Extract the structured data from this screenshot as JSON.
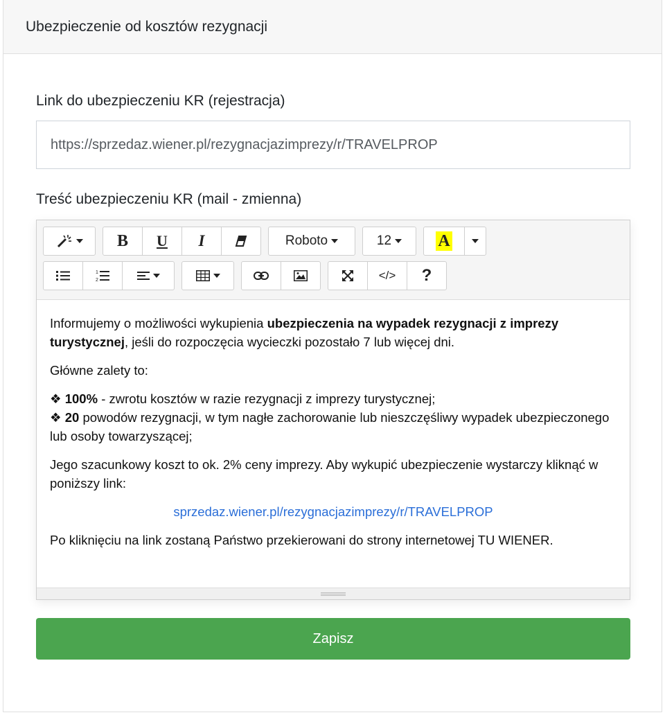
{
  "card": {
    "title": "Ubezpieczenie od kosztów rezygnacji"
  },
  "link_field": {
    "label": "Link do ubezpieczeniu KR (rejestracja)",
    "value": "https://sprzedaz.wiener.pl/rezygnacjazimprezy/r/TRAVELPROP"
  },
  "content_field": {
    "label": "Treść ubezpieczeniu KR (mail - zmienna)"
  },
  "toolbar": {
    "font_name": "Roboto",
    "font_size": "12",
    "bold_glyph": "B",
    "underline_glyph": "U",
    "italic_glyph": "I",
    "color_glyph": "A",
    "codeview_glyph": "</>",
    "help_glyph": "?",
    "highlight_color": "#ffff00"
  },
  "editor": {
    "p1_before": "Informujemy o możliwości wykupienia ",
    "p1_bold": "ubezpieczenia na wypadek rezygnacji z imprezy turystycznej",
    "p1_after": ", jeśli do rozpoczęcia wycieczki pozostało 7 lub więcej dni.",
    "p2": "Główne zalety to:",
    "bullet1_mark": "❖ ",
    "bullet1_bold": "100%",
    "bullet1_text": " - zwrotu kosztów w razie rezygnacji z imprezy turystycznej;",
    "bullet2_mark": "❖ ",
    "bullet2_bold": "20",
    "bullet2_text": " powodów rezygnacji, w tym nagłe zachorowanie lub nieszczęśliwy wypadek ubezpieczonego lub osoby towarzyszącej;",
    "p4": "Jego szacunkowy koszt to ok. 2% ceny imprezy. Aby wykupić ubezpieczenie wystarczy kliknąć w poniższy link:",
    "link": "sprzedaz.wiener.pl/rezygnacjazimprezy/r/TRAVELPROP",
    "p6": "Po kliknięciu na link zostaną Państwo przekierowani do strony internetowej TU WIENER."
  },
  "save_button": {
    "label": "Zapisz",
    "color": "#4ba54f"
  }
}
